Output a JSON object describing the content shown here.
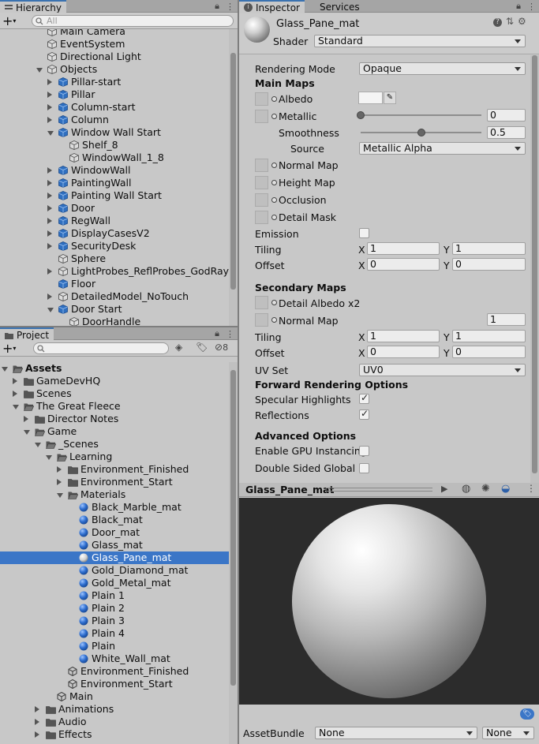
{
  "hierarchy": {
    "tab": "Hierarchy",
    "search_placeholder": "All",
    "items": [
      {
        "label": "Main Camera",
        "indent": 0,
        "icon": "cube-outline",
        "arrow": ""
      },
      {
        "label": "EventSystem",
        "indent": 0,
        "icon": "cube-outline",
        "arrow": ""
      },
      {
        "label": "Directional Light",
        "indent": 0,
        "icon": "cube-outline",
        "arrow": ""
      },
      {
        "label": "Objects",
        "indent": 0,
        "icon": "cube-outline",
        "arrow": "down"
      },
      {
        "label": "Pillar-start",
        "indent": 1,
        "icon": "cube-blue",
        "arrow": "right"
      },
      {
        "label": "Pillar",
        "indent": 1,
        "icon": "cube-blue",
        "arrow": "right"
      },
      {
        "label": "Column-start",
        "indent": 1,
        "icon": "cube-blue",
        "arrow": "right"
      },
      {
        "label": "Column",
        "indent": 1,
        "icon": "cube-blue",
        "arrow": "right"
      },
      {
        "label": "Window Wall Start",
        "indent": 1,
        "icon": "cube-blue",
        "arrow": "down"
      },
      {
        "label": "Shelf_8",
        "indent": 2,
        "icon": "cube-outline",
        "arrow": ""
      },
      {
        "label": "WindowWall_1_8",
        "indent": 2,
        "icon": "cube-outline",
        "arrow": ""
      },
      {
        "label": "WindowWall",
        "indent": 1,
        "icon": "cube-blue",
        "arrow": "right"
      },
      {
        "label": "PaintingWall",
        "indent": 1,
        "icon": "cube-blue",
        "arrow": "right"
      },
      {
        "label": "Painting Wall Start",
        "indent": 1,
        "icon": "cube-blue",
        "arrow": "right"
      },
      {
        "label": "Door",
        "indent": 1,
        "icon": "cube-blue",
        "arrow": "right"
      },
      {
        "label": "RegWall",
        "indent": 1,
        "icon": "cube-blue",
        "arrow": "right"
      },
      {
        "label": "DisplayCasesV2",
        "indent": 1,
        "icon": "cube-blue",
        "arrow": "right"
      },
      {
        "label": "SecurityDesk",
        "indent": 1,
        "icon": "cube-blue",
        "arrow": "right"
      },
      {
        "label": "Sphere",
        "indent": 1,
        "icon": "cube-outline",
        "arrow": ""
      },
      {
        "label": "LightProbes_ReflProbes_GodRays",
        "indent": 1,
        "icon": "cube-outline",
        "arrow": "right"
      },
      {
        "label": "Floor",
        "indent": 1,
        "icon": "cube-blue",
        "arrow": ""
      },
      {
        "label": "DetailedModel_NoTouch",
        "indent": 1,
        "icon": "cube-outline",
        "arrow": "right"
      },
      {
        "label": "Door Start",
        "indent": 1,
        "icon": "cube-blue",
        "arrow": "down"
      },
      {
        "label": "DoorHandle",
        "indent": 2,
        "icon": "cube-outline",
        "arrow": ""
      }
    ]
  },
  "project": {
    "tab": "Project",
    "hidden_count": "8",
    "items": [
      {
        "label": "Assets",
        "indent": 0,
        "icon": "folder-open",
        "arrow": "down",
        "bold": true
      },
      {
        "label": "GameDevHQ",
        "indent": 1,
        "icon": "folder",
        "arrow": "right"
      },
      {
        "label": "Scenes",
        "indent": 1,
        "icon": "folder",
        "arrow": "right"
      },
      {
        "label": "The Great Fleece",
        "indent": 1,
        "icon": "folder-open",
        "arrow": "down"
      },
      {
        "label": "Director Notes",
        "indent": 2,
        "icon": "folder",
        "arrow": "right"
      },
      {
        "label": "Game",
        "indent": 2,
        "icon": "folder-open",
        "arrow": "down"
      },
      {
        "label": "_Scenes",
        "indent": 3,
        "icon": "folder-open",
        "arrow": "down"
      },
      {
        "label": "Learning",
        "indent": 4,
        "icon": "folder-open",
        "arrow": "down"
      },
      {
        "label": "Environment_Finished",
        "indent": 5,
        "icon": "folder",
        "arrow": "right"
      },
      {
        "label": "Environment_Start",
        "indent": 5,
        "icon": "folder",
        "arrow": "right"
      },
      {
        "label": "Materials",
        "indent": 5,
        "icon": "folder-open",
        "arrow": "down"
      },
      {
        "label": "Black_Marble_mat",
        "indent": 6,
        "icon": "material",
        "arrow": ""
      },
      {
        "label": "Black_mat",
        "indent": 6,
        "icon": "material",
        "arrow": ""
      },
      {
        "label": "Door_mat",
        "indent": 6,
        "icon": "material",
        "arrow": ""
      },
      {
        "label": "Glass_mat",
        "indent": 6,
        "icon": "material",
        "arrow": ""
      },
      {
        "label": "Glass_Pane_mat",
        "indent": 6,
        "icon": "material-white",
        "arrow": "",
        "selected": true
      },
      {
        "label": "Gold_Diamond_mat",
        "indent": 6,
        "icon": "material",
        "arrow": ""
      },
      {
        "label": "Gold_Metal_mat",
        "indent": 6,
        "icon": "material",
        "arrow": ""
      },
      {
        "label": "Plain 1",
        "indent": 6,
        "icon": "material",
        "arrow": ""
      },
      {
        "label": "Plain 2",
        "indent": 6,
        "icon": "material",
        "arrow": ""
      },
      {
        "label": "Plain 3",
        "indent": 6,
        "icon": "material",
        "arrow": ""
      },
      {
        "label": "Plain 4",
        "indent": 6,
        "icon": "material",
        "arrow": ""
      },
      {
        "label": "Plain",
        "indent": 6,
        "icon": "material",
        "arrow": ""
      },
      {
        "label": "White_Wall_mat",
        "indent": 6,
        "icon": "material",
        "arrow": ""
      },
      {
        "label": "Environment_Finished",
        "indent": 5,
        "icon": "unity-scene",
        "arrow": ""
      },
      {
        "label": "Environment_Start",
        "indent": 5,
        "icon": "unity-scene",
        "arrow": ""
      },
      {
        "label": "Main",
        "indent": 4,
        "icon": "unity-scene",
        "arrow": ""
      },
      {
        "label": "Animations",
        "indent": 3,
        "icon": "folder",
        "arrow": "right"
      },
      {
        "label": "Audio",
        "indent": 3,
        "icon": "folder",
        "arrow": "right"
      },
      {
        "label": "Effects",
        "indent": 3,
        "icon": "folder",
        "arrow": "right"
      }
    ]
  },
  "inspector": {
    "tabs": [
      "Inspector",
      "Services"
    ],
    "material_name": "Glass_Pane_mat",
    "shader_label": "Shader",
    "shader_value": "Standard",
    "rendering_mode_label": "Rendering Mode",
    "rendering_mode_value": "Opaque",
    "main_maps": "Main Maps",
    "albedo": "Albedo",
    "metallic": "Metallic",
    "metallic_value": "0",
    "metallic_fraction": 0,
    "smoothness": "Smoothness",
    "smoothness_value": "0.5",
    "smoothness_fraction": 0.5,
    "source": "Source",
    "source_value": "Metallic Alpha",
    "normal_map": "Normal Map",
    "height_map": "Height Map",
    "occlusion": "Occlusion",
    "detail_mask": "Detail Mask",
    "emission": "Emission",
    "tiling": "Tiling",
    "offset": "Offset",
    "x": "X",
    "y": "Y",
    "tiling_x": "1",
    "tiling_y": "1",
    "offset_x": "0",
    "offset_y": "0",
    "secondary_maps": "Secondary Maps",
    "detail_albedo": "Detail Albedo x2",
    "sec_normal_map": "Normal Map",
    "sec_normal_value": "1",
    "sec_tiling_x": "1",
    "sec_tiling_y": "1",
    "sec_offset_x": "0",
    "sec_offset_y": "0",
    "uv_set": "UV Set",
    "uv_set_value": "UV0",
    "forward_options": "Forward Rendering Options",
    "specular_highlights": "Specular Highlights",
    "reflections": "Reflections",
    "advanced_options": "Advanced Options",
    "gpu_instancing": "Enable GPU Instancing",
    "double_sided": "Double Sided Global Illu"
  },
  "preview": {
    "title": "Glass_Pane_mat",
    "assetbundle_label": "AssetBundle",
    "assetbundle_value": "None",
    "variant_value": "None"
  },
  "colors": {
    "selection": "#3b76c7",
    "panel": "#c8c8c8",
    "preview_bg": "#2c2c2c",
    "tab_accent": "#3a72b0"
  }
}
